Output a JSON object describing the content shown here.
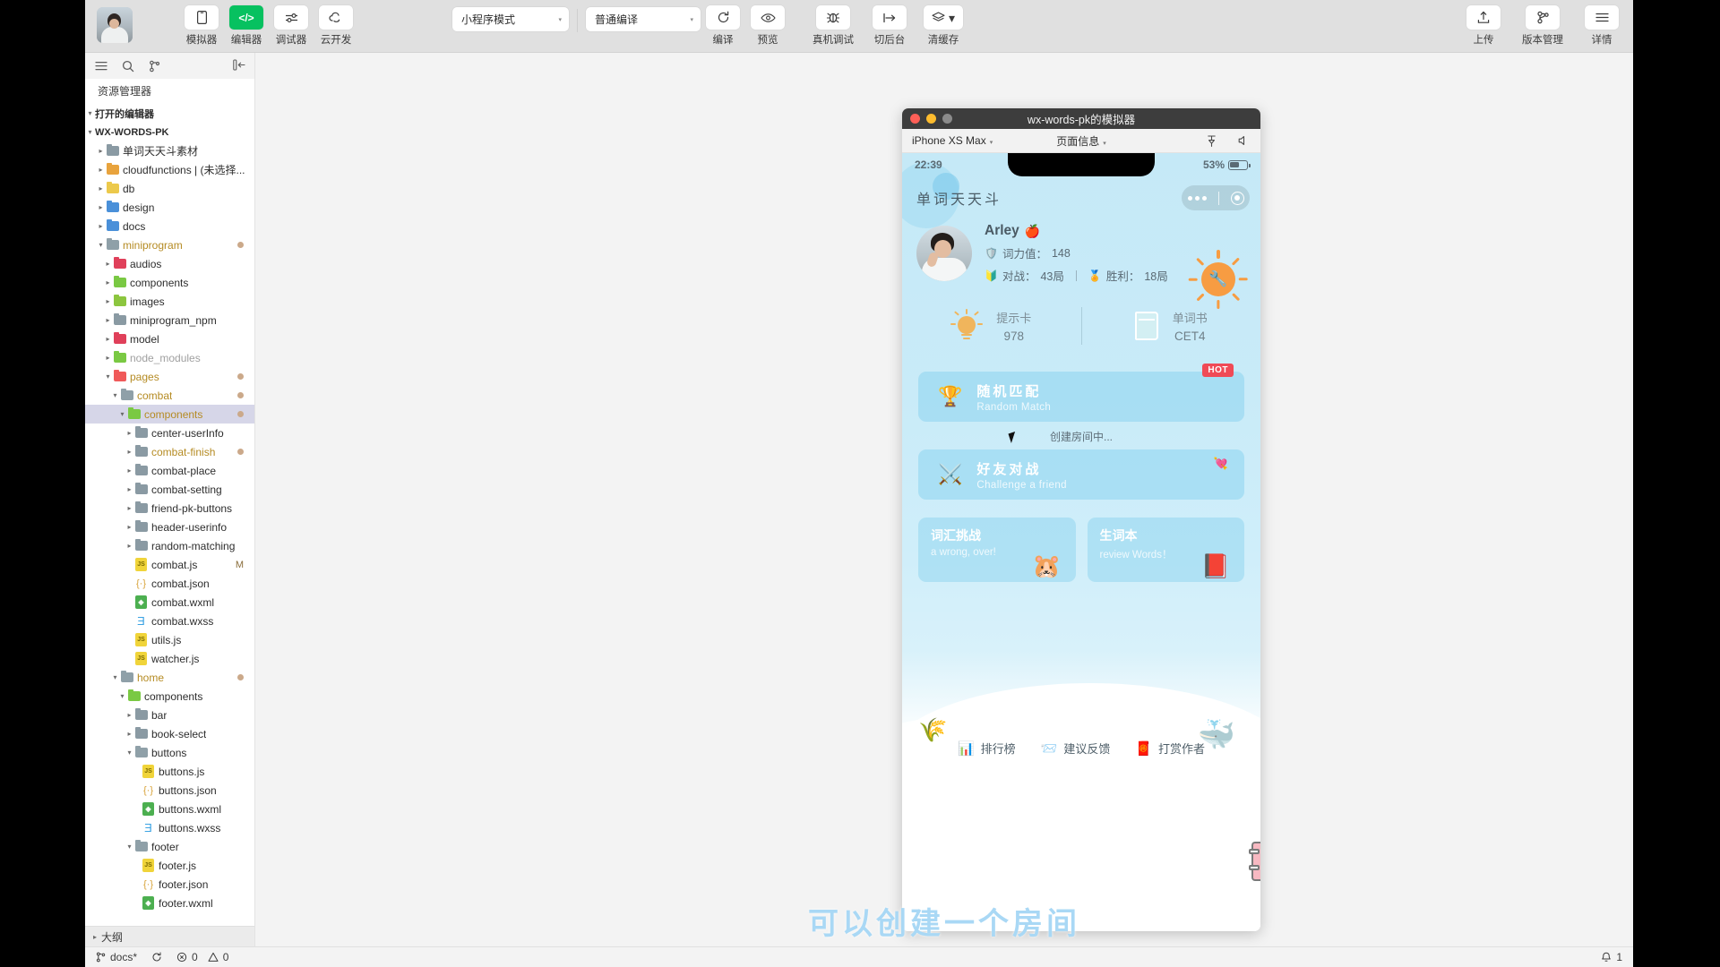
{
  "toolbar": {
    "left_tools": [
      {
        "label": "模拟器",
        "icon": "phone-icon",
        "active": false
      },
      {
        "label": "编辑器",
        "icon": "code-icon",
        "active": true
      },
      {
        "label": "调试器",
        "icon": "debug-sliders-icon",
        "active": false
      },
      {
        "label": "云开发",
        "icon": "cloud-icon",
        "active": false
      }
    ],
    "mode_select": {
      "value": "小程序模式",
      "caret": "▾"
    },
    "compile_select": {
      "value": "普通编译",
      "caret": "▾"
    },
    "compile_pair": [
      {
        "label": "编译",
        "icon": "refresh-icon"
      },
      {
        "label": "预览",
        "icon": "eye-icon"
      }
    ],
    "device_tools": [
      {
        "label": "真机调试",
        "icon": "bug-icon"
      },
      {
        "label": "切后台",
        "icon": "background-icon"
      },
      {
        "label": "清缓存",
        "icon": "layers-icon",
        "caret": "▾"
      }
    ],
    "right_tools": [
      {
        "label": "上传",
        "icon": "upload-icon"
      },
      {
        "label": "版本管理",
        "icon": "git-branch-icon"
      },
      {
        "label": "详情",
        "icon": "menu-icon"
      }
    ]
  },
  "explorer": {
    "actions": [
      "list-icon",
      "search-icon",
      "source-control-icon",
      "collapse-panel-icon"
    ],
    "title": "资源管理器",
    "open_editors": "打开的编辑器",
    "project": "WX-WORDS-PK",
    "outline": "大纲",
    "tree": [
      {
        "label": "单词天天斗素材",
        "indent": 1,
        "type": "folder",
        "color": "f-grey",
        "twisty": "▸"
      },
      {
        "label": "cloudfunctions | (未选择...",
        "indent": 1,
        "type": "folder",
        "color": "f-amber",
        "twisty": "▸"
      },
      {
        "label": "db",
        "indent": 1,
        "type": "folder",
        "color": "f-yellow",
        "twisty": "▸"
      },
      {
        "label": "design",
        "indent": 1,
        "type": "folder",
        "color": "f-blue",
        "twisty": "▸"
      },
      {
        "label": "docs",
        "indent": 1,
        "type": "folder",
        "color": "f-blue",
        "twisty": "▸"
      },
      {
        "label": "miniprogram",
        "indent": 1,
        "type": "folder",
        "color": "f-open",
        "twisty": "▾",
        "amber": true,
        "dot": true
      },
      {
        "label": "audios",
        "indent": 2,
        "type": "folder",
        "color": "f-red",
        "twisty": "▸"
      },
      {
        "label": "components",
        "indent": 2,
        "type": "folder",
        "color": "f-lgreen",
        "twisty": "▸"
      },
      {
        "label": "images",
        "indent": 2,
        "type": "folder",
        "color": "f-green",
        "twisty": "▸"
      },
      {
        "label": "miniprogram_npm",
        "indent": 2,
        "type": "folder",
        "color": "f-grey",
        "twisty": "▸"
      },
      {
        "label": "model",
        "indent": 2,
        "type": "folder",
        "color": "f-red",
        "twisty": "▸"
      },
      {
        "label": "node_modules",
        "indent": 2,
        "type": "folder",
        "color": "f-lgreen",
        "twisty": "▸",
        "dim": true
      },
      {
        "label": "pages",
        "indent": 2,
        "type": "folder",
        "color": "f-rose",
        "twisty": "▾",
        "amber": true,
        "dot": true
      },
      {
        "label": "combat",
        "indent": 3,
        "type": "folder",
        "color": "f-open",
        "twisty": "▾",
        "amber": true,
        "dot": true
      },
      {
        "label": "components",
        "indent": 4,
        "type": "folder",
        "color": "f-lgreen",
        "twisty": "▾",
        "amber": true,
        "dot": true,
        "selected": true
      },
      {
        "label": "center-userInfo",
        "indent": 5,
        "type": "folder",
        "color": "f-grey",
        "twisty": "▸"
      },
      {
        "label": "combat-finish",
        "indent": 5,
        "type": "folder",
        "color": "f-grey",
        "twisty": "▸",
        "amber": true,
        "dot": true
      },
      {
        "label": "combat-place",
        "indent": 5,
        "type": "folder",
        "color": "f-grey",
        "twisty": "▸"
      },
      {
        "label": "combat-setting",
        "indent": 5,
        "type": "folder",
        "color": "f-grey",
        "twisty": "▸"
      },
      {
        "label": "friend-pk-buttons",
        "indent": 5,
        "type": "folder",
        "color": "f-grey",
        "twisty": "▸"
      },
      {
        "label": "header-userinfo",
        "indent": 5,
        "type": "folder",
        "color": "f-grey",
        "twisty": "▸"
      },
      {
        "label": "random-matching",
        "indent": 5,
        "type": "folder",
        "color": "f-grey",
        "twisty": "▸"
      },
      {
        "label": "combat.js",
        "indent": 5,
        "type": "js",
        "mark": "M"
      },
      {
        "label": "combat.json",
        "indent": 5,
        "type": "json"
      },
      {
        "label": "combat.wxml",
        "indent": 5,
        "type": "wxml"
      },
      {
        "label": "combat.wxss",
        "indent": 5,
        "type": "wxss"
      },
      {
        "label": "utils.js",
        "indent": 5,
        "type": "js"
      },
      {
        "label": "watcher.js",
        "indent": 5,
        "type": "js"
      },
      {
        "label": "home",
        "indent": 3,
        "type": "folder",
        "color": "f-open",
        "twisty": "▾",
        "amber": true,
        "dot": true
      },
      {
        "label": "components",
        "indent": 4,
        "type": "folder",
        "color": "f-lgreen",
        "twisty": "▾"
      },
      {
        "label": "bar",
        "indent": 5,
        "type": "folder",
        "color": "f-grey",
        "twisty": "▸"
      },
      {
        "label": "book-select",
        "indent": 5,
        "type": "folder",
        "color": "f-grey",
        "twisty": "▸"
      },
      {
        "label": "buttons",
        "indent": 5,
        "type": "folder",
        "color": "f-open",
        "twisty": "▾"
      },
      {
        "label": "buttons.js",
        "indent": 6,
        "type": "js"
      },
      {
        "label": "buttons.json",
        "indent": 6,
        "type": "json"
      },
      {
        "label": "buttons.wxml",
        "indent": 6,
        "type": "wxml"
      },
      {
        "label": "buttons.wxss",
        "indent": 6,
        "type": "wxss"
      },
      {
        "label": "footer",
        "indent": 5,
        "type": "folder",
        "color": "f-open",
        "twisty": "▾"
      },
      {
        "label": "footer.js",
        "indent": 6,
        "type": "js"
      },
      {
        "label": "footer.json",
        "indent": 6,
        "type": "json"
      },
      {
        "label": "footer.wxml",
        "indent": 6,
        "type": "wxml"
      }
    ]
  },
  "simulator": {
    "window_title": "wx-words-pk的模拟器",
    "device": "iPhone XS Max",
    "device_caret": "▾",
    "page_info": "页面信息",
    "page_info_caret": "▾",
    "header_icons": [
      "pin-icon",
      "volume-icon"
    ]
  },
  "app": {
    "status_time": "22:39",
    "battery_percent": "53%",
    "nav_title": "单词天天斗",
    "user": {
      "name": "Arley",
      "name_emoji": "🍎",
      "power_label": "词力值：",
      "power_value": "148",
      "battles_label": "对战：",
      "battles_value": "43局",
      "wins_label": "胜利：",
      "wins_value": "18局",
      "power_icon": "shield-icon",
      "battle_icon": "flag-icon",
      "win_icon": "trophy-icon"
    },
    "stats": [
      {
        "label": "提示卡",
        "value": "978",
        "icon": "bulb-icon"
      },
      {
        "label": "单词书",
        "value": "CET4",
        "icon": "book-icon"
      }
    ],
    "cta": [
      {
        "title": "随机匹配",
        "subtitle": "Random Match",
        "icon": "trophy-icon",
        "badge": "HOT"
      },
      {
        "title": "好友对战",
        "subtitle": "Challenge a friend",
        "icon": "crossed-swords-icon",
        "badge": ""
      }
    ],
    "creating_text": "创建房间中...",
    "mini_cards": [
      {
        "title": "词汇挑战",
        "subtitle": "a wrong, over!",
        "icon": "pikachu-icon"
      },
      {
        "title": "生词本",
        "subtitle": "review Words！",
        "icon": "red-book-icon"
      }
    ],
    "foot_nav": [
      {
        "label": "排行榜",
        "icon": "bar-chart-icon"
      },
      {
        "label": "建议反馈",
        "icon": "feedback-icon"
      },
      {
        "label": "打赏作者",
        "icon": "reward-icon"
      }
    ]
  },
  "subtitle": "可以创建一个房间",
  "status_bar": {
    "branch": "docs*",
    "branch_icon": "git-branch-icon",
    "sync_icon": "sync-icon",
    "errors": "0",
    "warnings": "0",
    "error_icon": "error-circle-icon",
    "warning_icon": "warning-triangle-icon",
    "bell_icon": "bell-icon",
    "bell_count": "1"
  },
  "colors": {
    "accent_green": "#07c160",
    "app_blue": "#c5e9f7",
    "card_blue": "#93d6f0",
    "hot_red": "#f04a56",
    "sun_orange": "#f79c42",
    "selection": "#d6d6e8"
  }
}
